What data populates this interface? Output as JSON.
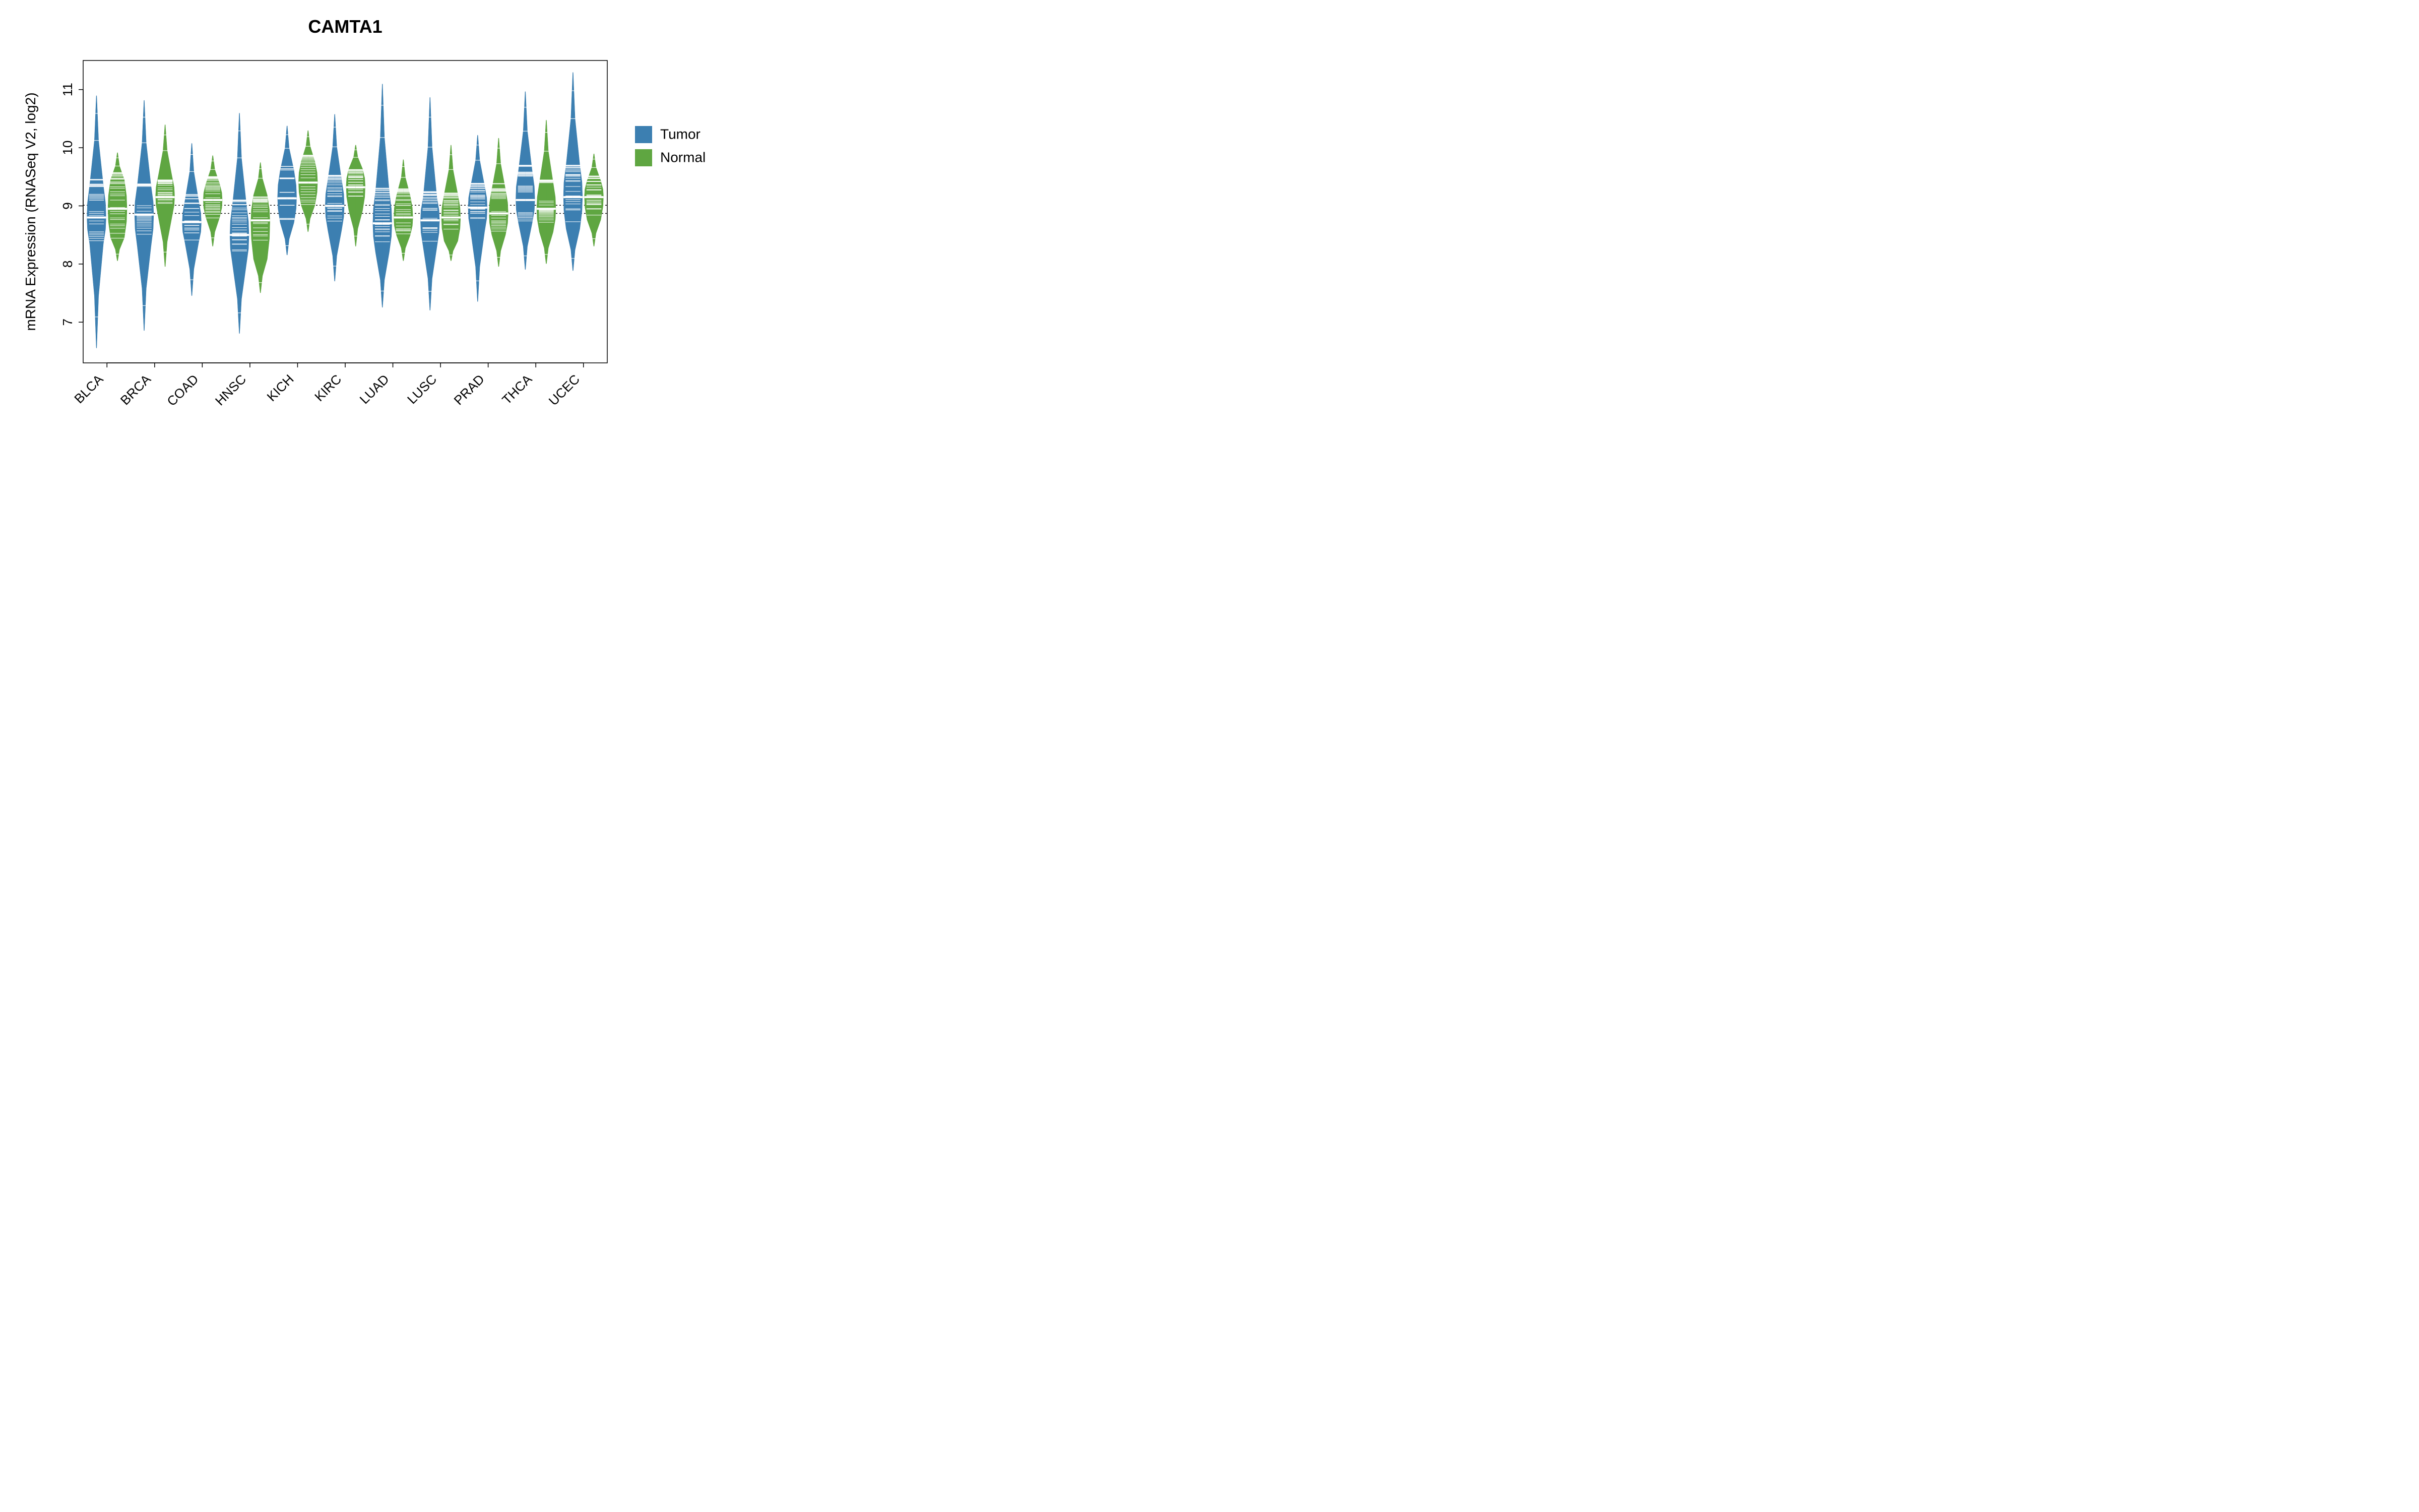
{
  "chart_data": {
    "type": "beanplot",
    "title": "CAMTA1",
    "ylabel": "mRNA Expression (RNASeq V2, log2)",
    "xlabel": "",
    "ylim": [
      6.3,
      11.5
    ],
    "y_ticks": [
      7,
      8,
      9,
      10,
      11
    ],
    "categories": [
      "BLCA",
      "BRCA",
      "COAD",
      "HNSC",
      "KICH",
      "KIRC",
      "LUAD",
      "LUSC",
      "PRAD",
      "THCA",
      "UCEC"
    ],
    "legend": {
      "entries": [
        "Tumor",
        "Normal"
      ],
      "colors": [
        "#3c7fb1",
        "#5fa641"
      ]
    },
    "reference_lines": [
      9.01,
      8.87
    ],
    "series": [
      {
        "name": "Tumor",
        "color": "#3c7fb1",
        "distributions": [
          {
            "median": 8.8,
            "q1": 8.35,
            "q3": 9.35,
            "low": 6.55,
            "high": 10.9,
            "skew": 0.0
          },
          {
            "median": 8.85,
            "q1": 8.3,
            "q3": 9.35,
            "low": 6.85,
            "high": 10.82,
            "skew": 0.0
          },
          {
            "median": 8.72,
            "q1": 8.38,
            "q3": 9.1,
            "low": 7.45,
            "high": 10.08,
            "skew": -0.1
          },
          {
            "median": 8.5,
            "q1": 8.0,
            "q3": 9.05,
            "low": 6.8,
            "high": 10.6,
            "skew": -0.1
          },
          {
            "median": 9.13,
            "q1": 8.7,
            "q3": 9.6,
            "low": 8.15,
            "high": 10.38,
            "skew": 0.1
          },
          {
            "median": 9.0,
            "q1": 8.58,
            "q3": 9.45,
            "low": 7.7,
            "high": 10.58,
            "skew": 0.0
          },
          {
            "median": 8.7,
            "q1": 8.2,
            "q3": 9.25,
            "low": 7.25,
            "high": 11.1,
            "skew": 0.0
          },
          {
            "median": 8.75,
            "q1": 8.3,
            "q3": 9.15,
            "low": 7.2,
            "high": 10.87,
            "skew": -0.05
          },
          {
            "median": 8.97,
            "q1": 8.55,
            "q3": 9.35,
            "low": 7.35,
            "high": 10.22,
            "skew": 0.0
          },
          {
            "median": 9.1,
            "q1": 8.7,
            "q3": 9.6,
            "low": 7.9,
            "high": 10.97,
            "skew": 0.05
          },
          {
            "median": 9.15,
            "q1": 8.6,
            "q3": 9.7,
            "low": 7.88,
            "high": 11.3,
            "skew": 0.05
          }
        ]
      },
      {
        "name": "Normal",
        "color": "#5fa641",
        "distributions": [
          {
            "median": 8.95,
            "q1": 8.45,
            "q3": 9.45,
            "low": 8.05,
            "high": 9.92,
            "skew": 0.0
          },
          {
            "median": 9.15,
            "q1": 8.8,
            "q3": 9.5,
            "low": 7.95,
            "high": 10.4,
            "skew": 0.1
          },
          {
            "median": 9.1,
            "q1": 8.8,
            "q3": 9.38,
            "low": 8.3,
            "high": 9.87,
            "skew": 0.0
          },
          {
            "median": 8.75,
            "q1": 8.1,
            "q3": 9.2,
            "low": 7.5,
            "high": 9.75,
            "skew": -0.15
          },
          {
            "median": 9.4,
            "q1": 9.0,
            "q3": 9.75,
            "low": 8.55,
            "high": 10.3,
            "skew": 0.1
          },
          {
            "median": 9.32,
            "q1": 8.9,
            "q3": 9.62,
            "low": 8.3,
            "high": 10.05,
            "skew": 0.15
          },
          {
            "median": 8.8,
            "q1": 8.5,
            "q3": 9.18,
            "low": 8.05,
            "high": 9.8,
            "skew": -0.05
          },
          {
            "median": 8.8,
            "q1": 8.4,
            "q3": 9.2,
            "low": 8.05,
            "high": 10.05,
            "skew": -0.05
          },
          {
            "median": 8.87,
            "q1": 8.5,
            "q3": 9.28,
            "low": 7.95,
            "high": 10.17,
            "skew": 0.0
          },
          {
            "median": 8.95,
            "q1": 8.55,
            "q3": 9.4,
            "low": 8.0,
            "high": 10.48,
            "skew": 0.0
          },
          {
            "median": 9.15,
            "q1": 8.75,
            "q3": 9.42,
            "low": 8.3,
            "high": 9.9,
            "skew": 0.1
          }
        ]
      }
    ]
  }
}
